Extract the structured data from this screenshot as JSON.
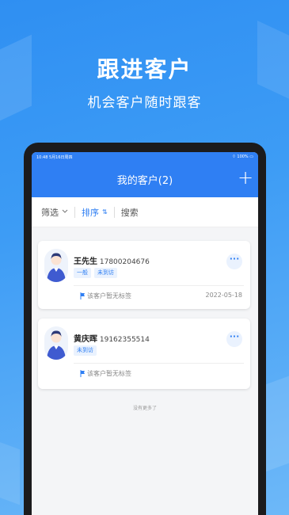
{
  "hero": {
    "title": "跟进客户",
    "subtitle": "机会客户随时跟客"
  },
  "statusbar": {
    "left": "10:48  5月16日周四",
    "right": "⌔ 100% ▭"
  },
  "navbar": {
    "title": "我的客户(2)",
    "add_label": "+"
  },
  "filters": {
    "filter_label": "筛选",
    "filter_icon": "chevron-down-icon",
    "sort_label": "排序",
    "sort_icon": "sort-arrows-icon",
    "search_label": "搜索"
  },
  "customers": [
    {
      "name": "王先生",
      "phone": "17800204676",
      "tags": [
        "一般",
        "未到访"
      ],
      "label_text": "该客户暂无标签",
      "date": "2022-05-18",
      "more_label": "···"
    },
    {
      "name": "黄庆晖",
      "phone": "19162355514",
      "tags": [
        "未到访"
      ],
      "label_text": "该客户暂无标签",
      "date": "",
      "more_label": "···"
    }
  ],
  "footer": {
    "no_more_text": "没有更多了"
  },
  "colors": {
    "accent": "#2f7ff3",
    "tag_bg": "#eaf2fe"
  }
}
